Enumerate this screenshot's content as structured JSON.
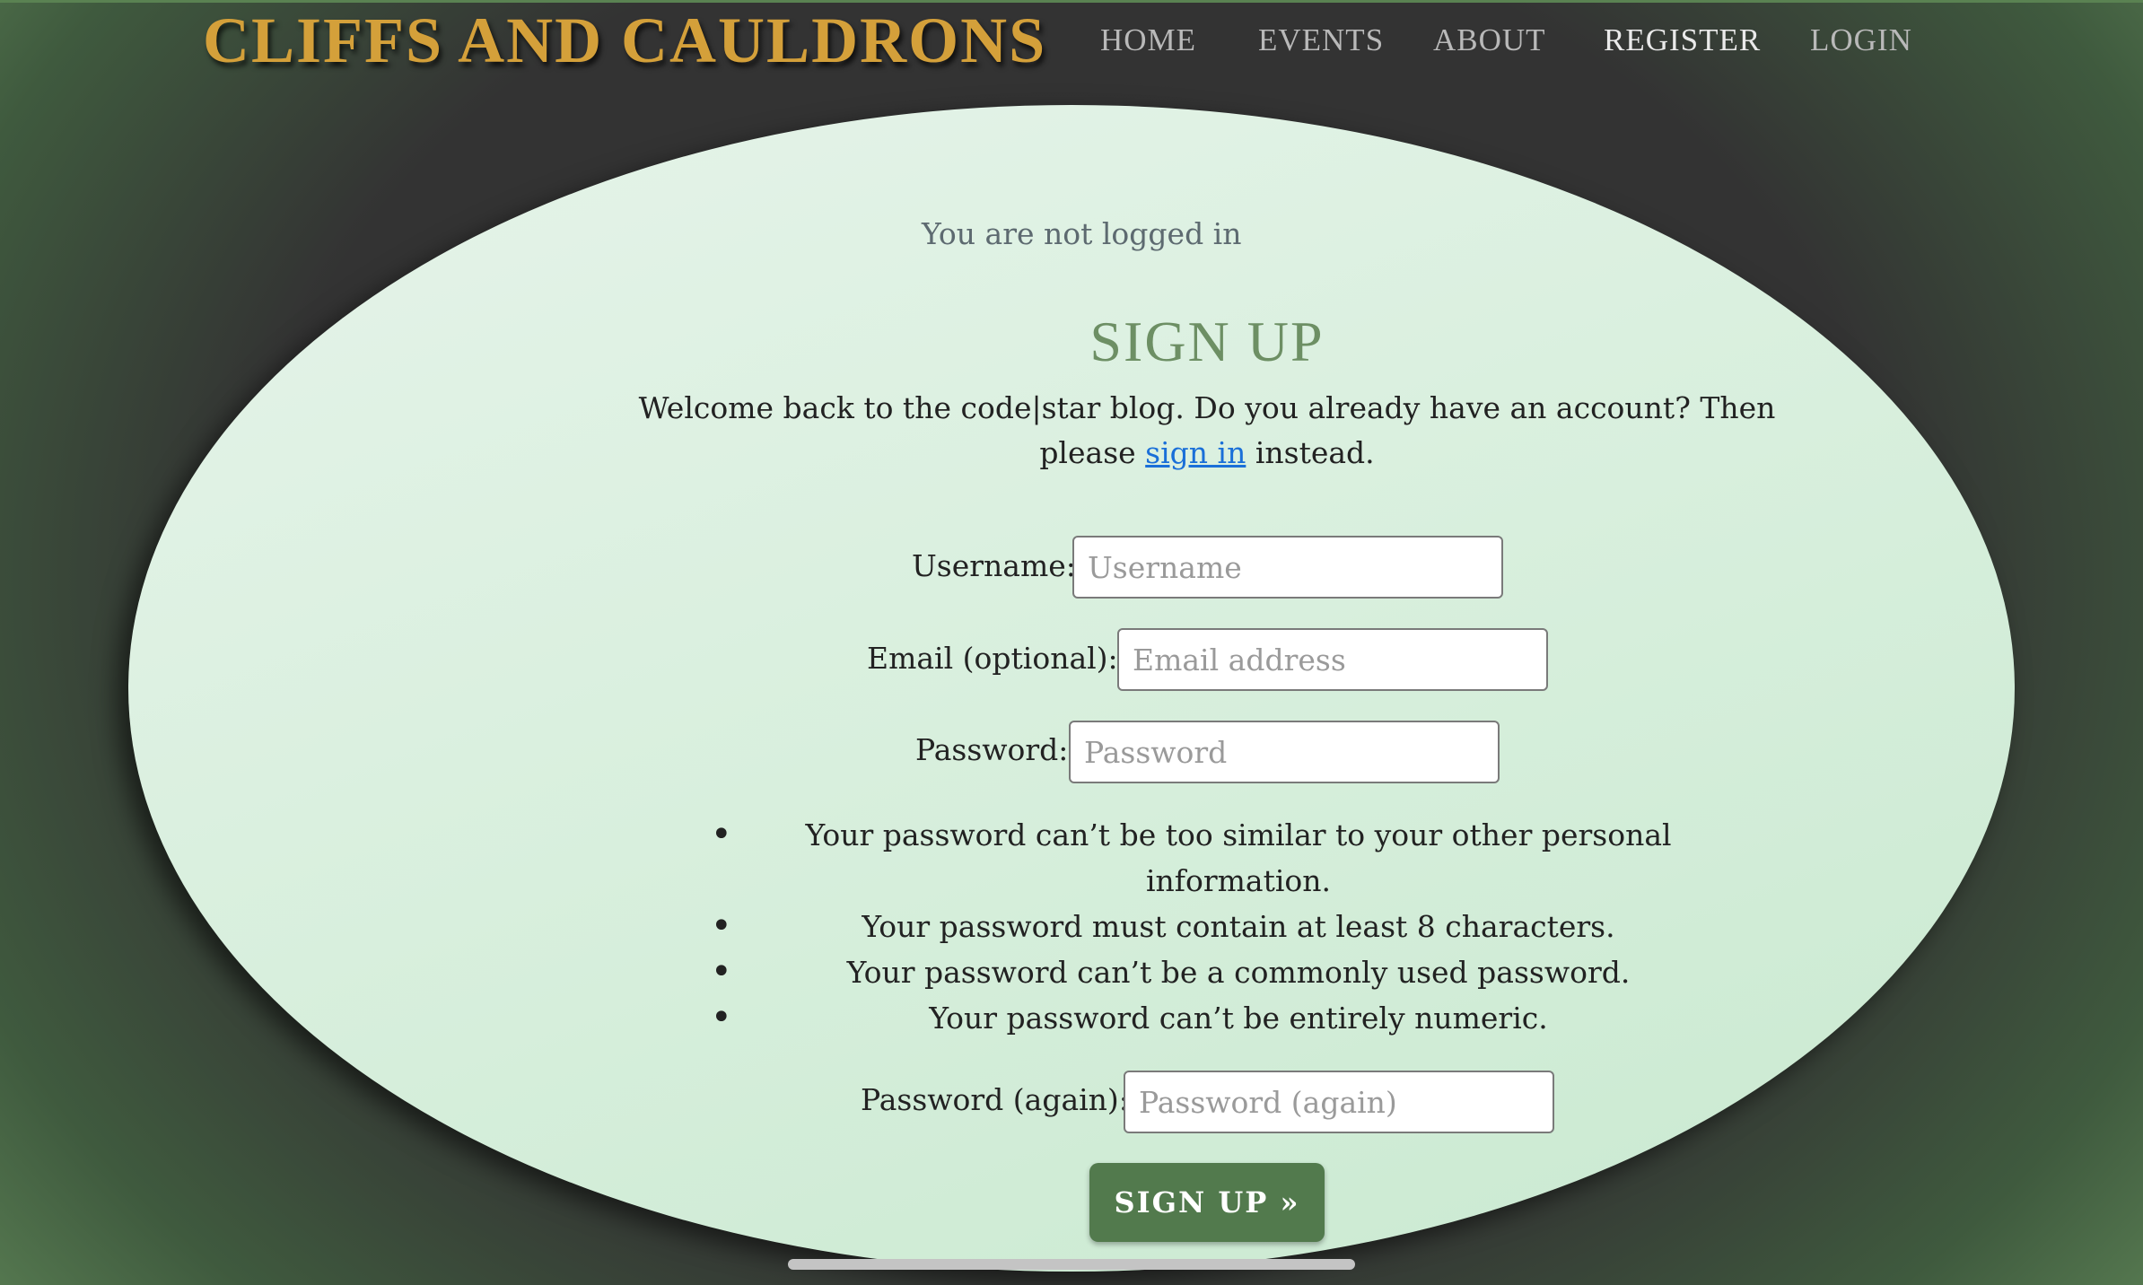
{
  "brand": {
    "title": "CLIFFS AND CAULDRONS"
  },
  "nav": {
    "items": [
      {
        "label": "HOME"
      },
      {
        "label": "EVENTS"
      },
      {
        "label": "ABOUT"
      },
      {
        "label": "REGISTER",
        "active": true
      },
      {
        "label": "LOGIN"
      }
    ]
  },
  "status": {
    "login_text": "You are not logged in"
  },
  "signup": {
    "heading": "SIGN UP",
    "welcome_text": "Welcome back to the code|star blog. Do you already have an account? Then please",
    "signin_link": "sign in",
    "welcome_suffix": "instead.",
    "fields": {
      "username": {
        "label": "Username:",
        "placeholder": "Username",
        "value": ""
      },
      "email": {
        "label": "Email (optional):",
        "placeholder": "Email address",
        "value": ""
      },
      "password": {
        "label": "Password:",
        "placeholder": "Password",
        "value": ""
      },
      "password_again": {
        "label": "Password (again):",
        "placeholder": "Password (again)",
        "value": ""
      }
    },
    "password_rules": [
      "Your password can’t be too similar to your other personal information.",
      "Your password must contain at least 8 characters.",
      "Your password can’t be a commonly used password.",
      "Your password can’t be entirely numeric."
    ],
    "button_label": "SIGN UP »"
  },
  "colors": {
    "brand": "#d4a03a",
    "oval_background": "#d8efdd",
    "button": "#527a4d",
    "link": "#1a6fd8",
    "heading": "#6d8f64"
  }
}
